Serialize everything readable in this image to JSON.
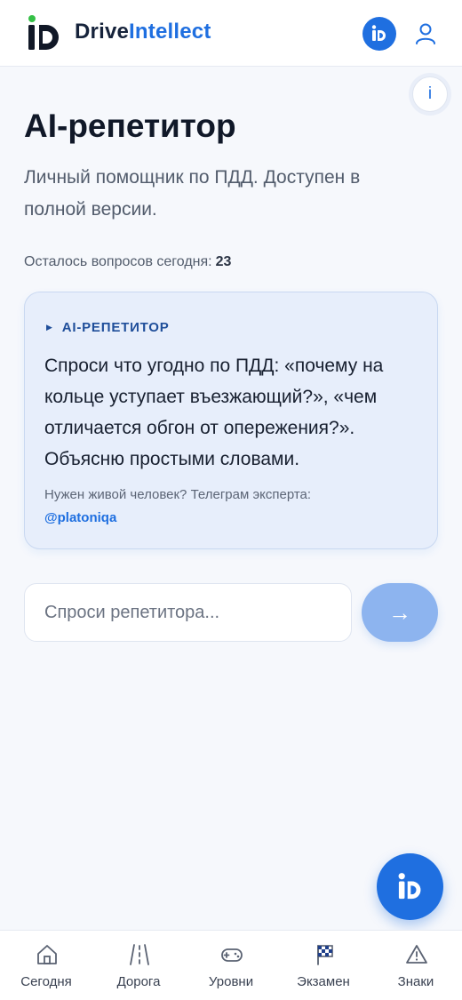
{
  "header": {
    "brand_part1": "Drive",
    "brand_part2": "Intellect",
    "icons": [
      "logo-icon",
      "brand-badge-icon",
      "user-icon"
    ]
  },
  "info_button": {
    "label": "i"
  },
  "page": {
    "title": "AI-репетитор",
    "subtitle": "Личный помощник по ПДД. Доступен в полной версии.",
    "remaining_label": "Осталось вопросов сегодня:",
    "remaining_count": "23"
  },
  "card": {
    "tag": "AI-РЕПЕТИТОР",
    "text": "Спроси что угодно по ПДД: «почему на кольце уступает въезжающий?», «чем отличается обгон от опережения?». Объясню простыми словами.",
    "note": "Нужен живой человек? Телеграм эксперта:",
    "link": "@platoniqa"
  },
  "chat_input": {
    "value": "",
    "placeholder": "Спроси репетитора...",
    "send_label": "→"
  },
  "colors": {
    "accent": "#1f6fe0",
    "card_bg": "#e7eefb",
    "send_disabled": "#8db4ef"
  },
  "nav": {
    "items": [
      {
        "label": "Сегодня",
        "icon": "home-icon"
      },
      {
        "label": "Дорога",
        "icon": "road-icon"
      },
      {
        "label": "Уровни",
        "icon": "gamepad-icon"
      },
      {
        "label": "Экзамен",
        "icon": "checkered-flag-icon"
      },
      {
        "label": "Знаки",
        "icon": "warning-sign-icon"
      }
    ]
  }
}
